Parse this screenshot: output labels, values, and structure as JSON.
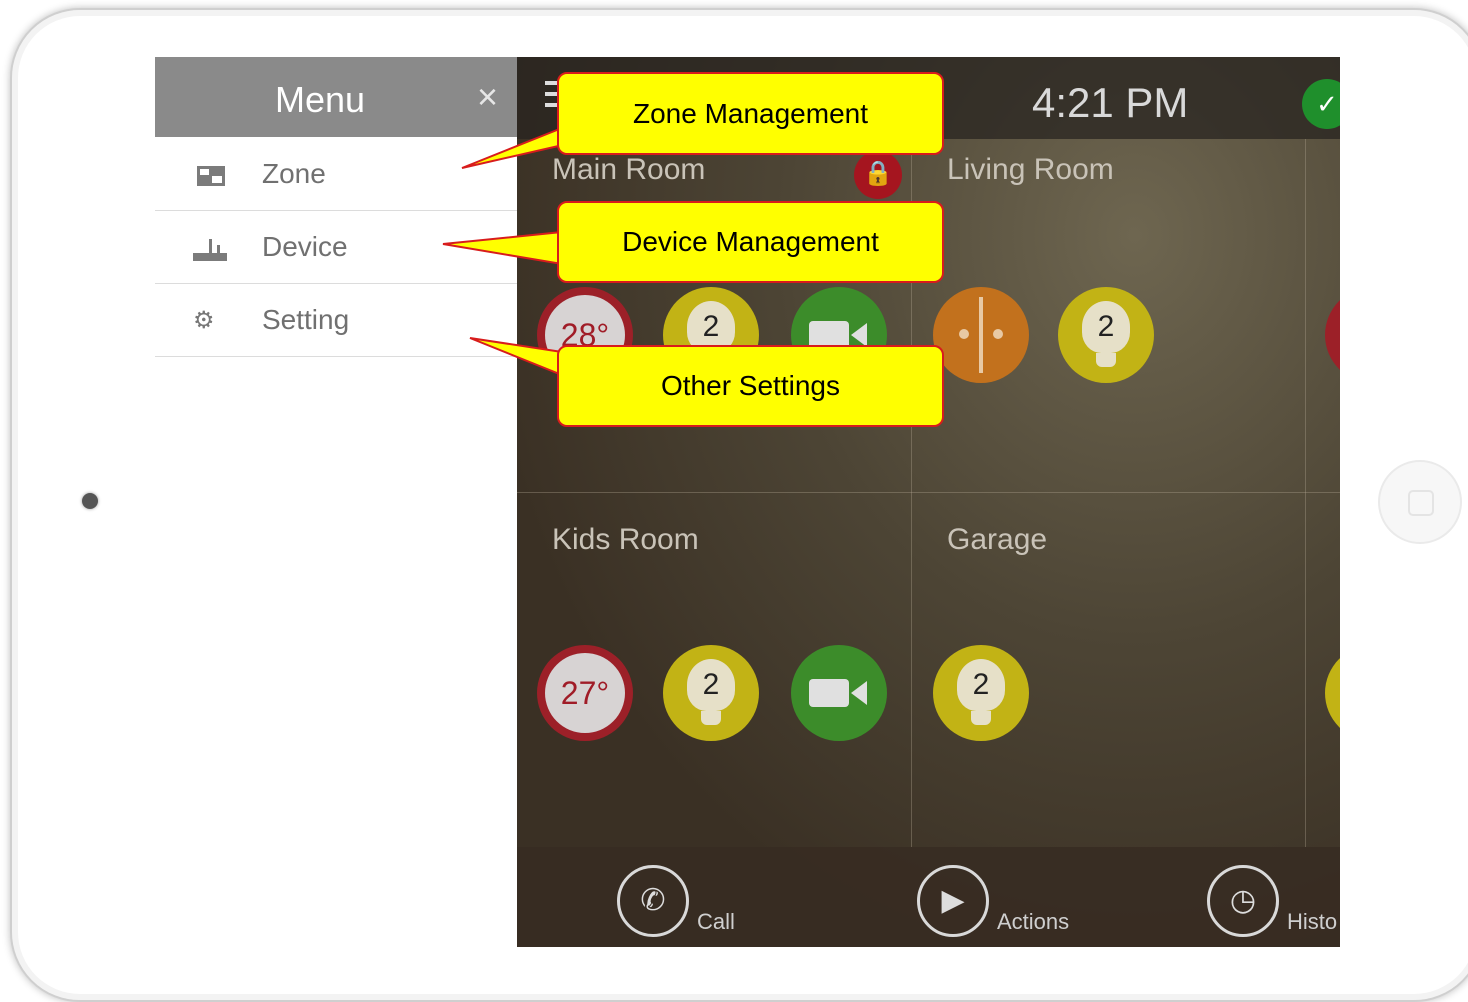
{
  "menu": {
    "title": "Menu",
    "close_label": "×",
    "items": [
      {
        "label": "Zone",
        "icon": "zone-icon"
      },
      {
        "label": "Device",
        "icon": "router-icon"
      },
      {
        "label": "Setting",
        "icon": "gear-icon"
      }
    ]
  },
  "header": {
    "time": "4:21 PM",
    "status_icon": "check-icon"
  },
  "rooms": [
    {
      "name": "Main Room",
      "locked": true
    },
    {
      "name": "Living Room"
    },
    {
      "name": "Kids Room"
    },
    {
      "name": "Garage"
    }
  ],
  "devices": {
    "main_thermostat": "28°",
    "main_light_count": "2",
    "living_light_count": "2",
    "kids_thermostat": "27°",
    "kids_light_count": "2",
    "garage_light_count": "2"
  },
  "bottom_bar": {
    "call": "Call",
    "actions": "Actions",
    "history": "Histo"
  },
  "callouts": {
    "zone": "Zone Management",
    "device": "Device Management",
    "settings": "Other Settings"
  },
  "colors": {
    "callout_fill": "#ffff00",
    "callout_border": "#d81c1c",
    "menu_header": "#8a8a8a",
    "thermostat": "#9c2028",
    "light": "#c2b315",
    "camera": "#3c8c2a",
    "door": "#c2711d"
  }
}
